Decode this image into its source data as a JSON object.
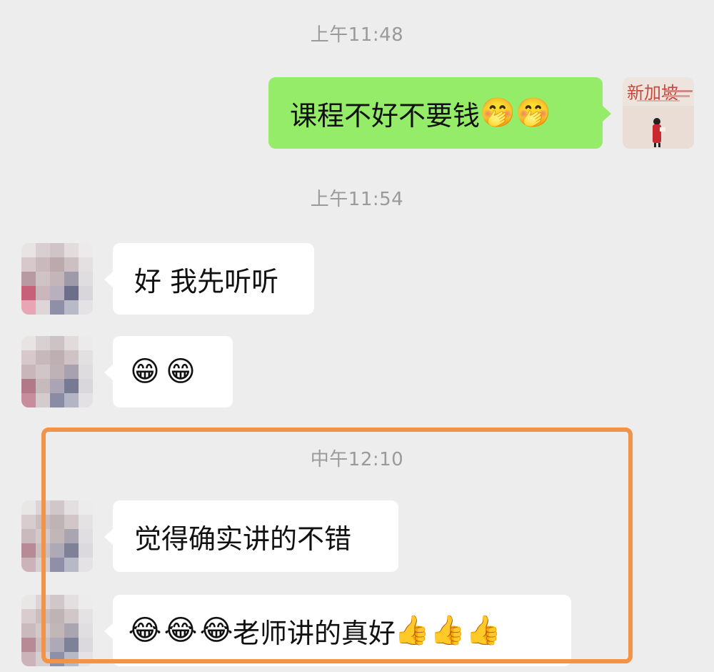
{
  "timestamps": {
    "t1": "上午11:48",
    "t2": "上午11:54",
    "t3": "中午12:10"
  },
  "messages": [
    {
      "side": "out",
      "text": "课程不好不要钱",
      "emojis": [
        "hand-over-mouth-emoji",
        "hand-over-mouth-emoji"
      ]
    },
    {
      "side": "in",
      "text": "好 我先听听"
    },
    {
      "side": "in",
      "text": "",
      "emojis": [
        "grinning-emoji",
        "grinning-emoji"
      ]
    },
    {
      "side": "in",
      "text": "觉得确实讲的不错"
    },
    {
      "side": "in",
      "text": "老师讲的真好",
      "emojis_before": [
        "tears-of-joy-emoji",
        "tears-of-joy-emoji",
        "tears-of-joy-emoji"
      ],
      "emojis_after": [
        "thumbs-up-emoji",
        "thumbs-up-emoji",
        "thumbs-up-emoji"
      ]
    }
  ],
  "self_avatar": {
    "text": "新加坡"
  },
  "colors": {
    "background": "#ededed",
    "outgoing_bubble": "#95ec69",
    "incoming_bubble": "#ffffff",
    "timestamp": "#9a9a9a",
    "highlight_border": "#f29448"
  }
}
